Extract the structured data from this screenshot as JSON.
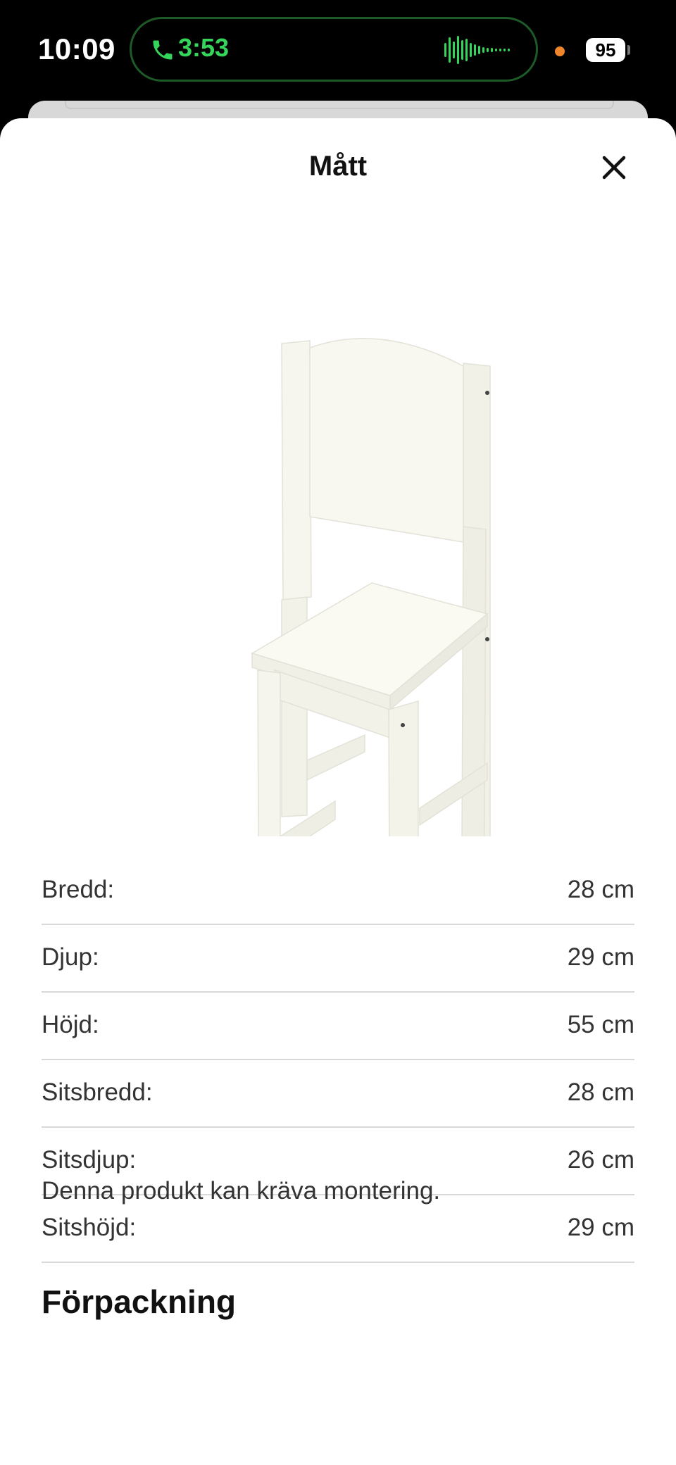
{
  "status_bar": {
    "time": "10:09",
    "call_timer": "3:53",
    "battery": "95",
    "call_color": "#35d45a",
    "mic_indicator_color": "#f0862a"
  },
  "sheet": {
    "title": "Mått",
    "close_icon": "close-icon",
    "product_image_alt": "chair"
  },
  "dimensions": [
    {
      "label": "Bredd:",
      "value": "28 cm"
    },
    {
      "label": "Djup:",
      "value": "29 cm"
    },
    {
      "label": "Höjd:",
      "value": "55 cm"
    },
    {
      "label": "Sitsbredd:",
      "value": "28 cm"
    },
    {
      "label": "Sitsdjup:",
      "value": "26 cm"
    },
    {
      "label": "Sitshöjd:",
      "value": "29 cm"
    }
  ],
  "assembly_note": "Denna produkt kan kräva montering.",
  "packaging_heading": "Förpackning"
}
